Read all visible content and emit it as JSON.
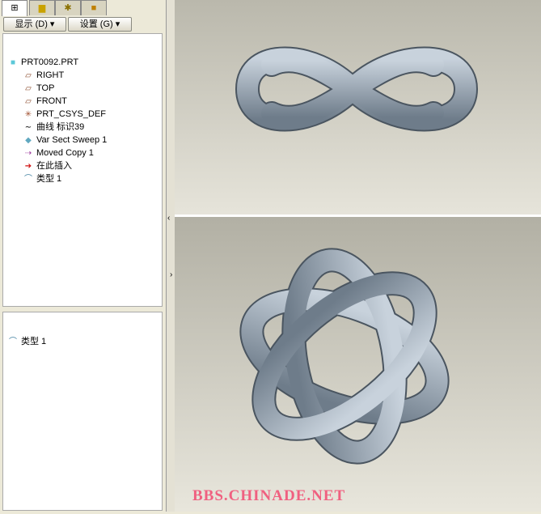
{
  "tabs": [
    {
      "icon": "model-tree-icon"
    },
    {
      "icon": "folder-browser-icon"
    },
    {
      "icon": "favorites-icon"
    },
    {
      "icon": "connections-icon"
    }
  ],
  "toolbar": {
    "show_label": "显示 (D) ▾",
    "settings_label": "设置 (G) ▾"
  },
  "tree": {
    "items": [
      {
        "label": "PRT0092.PRT",
        "icon": "part-icon"
      },
      {
        "label": "RIGHT",
        "icon": "datum-plane-icon"
      },
      {
        "label": "TOP",
        "icon": "datum-plane-icon"
      },
      {
        "label": "FRONT",
        "icon": "datum-plane-icon"
      },
      {
        "label": "PRT_CSYS_DEF",
        "icon": "csys-icon"
      },
      {
        "label": "曲线 标识39",
        "icon": "curve-icon"
      },
      {
        "label": "Var Sect Sweep 1",
        "icon": "sweep-icon"
      },
      {
        "label": "Moved Copy 1",
        "icon": "moved-copy-icon"
      },
      {
        "label": "在此插入",
        "icon": "insert-here-arrow-icon"
      },
      {
        "label": "类型 1",
        "icon": "quilt-icon"
      }
    ]
  },
  "lower": {
    "item": "类型 1"
  },
  "watermark": "BBS.CHINADE.NET",
  "colors": {
    "knot": "#8e9cab",
    "watermark": "#f06080"
  }
}
